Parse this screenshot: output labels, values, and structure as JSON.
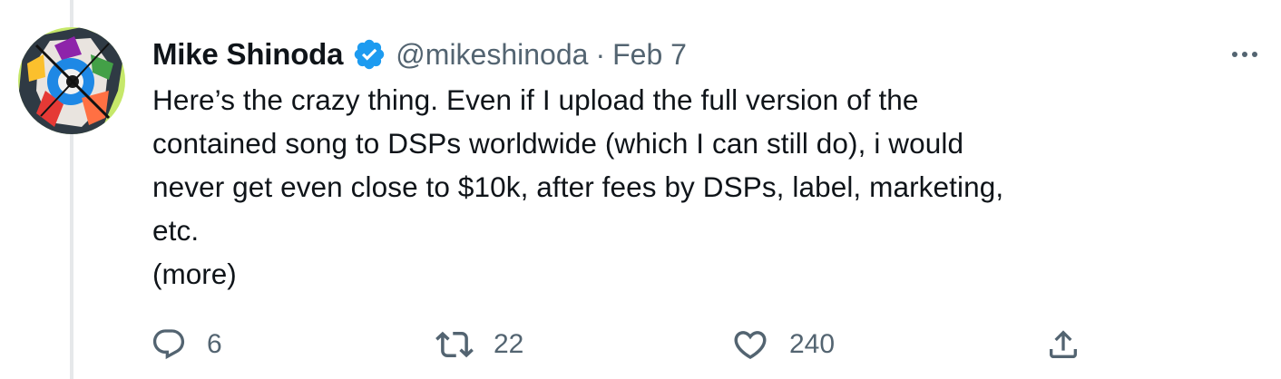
{
  "tweet": {
    "author": {
      "name": "Mike Shinoda",
      "handle": "@mikeshinoda",
      "verified": true,
      "avatar_icon": "avatar-image"
    },
    "separator": "·",
    "date": "Feb 7",
    "text_lines": [
      "Here’s the crazy thing. Even if I upload the full version of the",
      "contained song to DSPs worldwide (which I can still do), i would",
      "never get even close to $10k, after fees by DSPs, label, marketing,",
      "etc."
    ],
    "more_label": "(more)",
    "actions": {
      "reply": {
        "icon": "reply-icon",
        "count": "6"
      },
      "retweet": {
        "icon": "retweet-icon",
        "count": "22"
      },
      "like": {
        "icon": "heart-icon",
        "count": "240"
      },
      "share": {
        "icon": "share-icon"
      }
    },
    "colors": {
      "verified_blue": "#1d9bf0",
      "secondary_text": "#536471",
      "primary_text": "#0f1419",
      "thread_line": "#e6e8ea"
    }
  }
}
